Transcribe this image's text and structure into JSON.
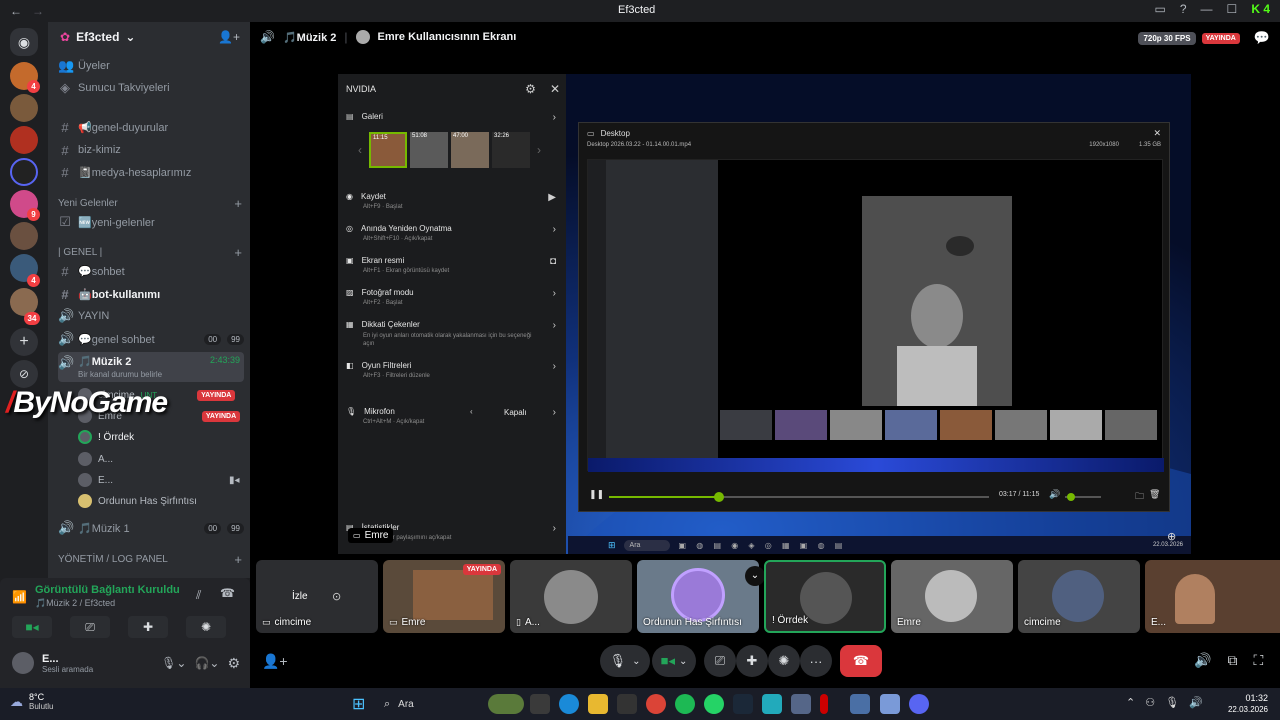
{
  "window": {
    "title": "Ef3cted",
    "nav_back": "←",
    "nav_fwd": "→"
  },
  "server": {
    "name": "Ef3cted",
    "items": [
      {
        "label": "Üyeler"
      },
      {
        "label": "Sunucu Takviyeleri"
      }
    ]
  },
  "channels": {
    "text": [
      {
        "label": "📢genel-duyurular"
      },
      {
        "label": "biz-kimiz"
      },
      {
        "label": "📓medya-hesaplarımız"
      }
    ],
    "cat_new": "Yeni Gelenler",
    "new_channel": "🆕yeni-gelenler",
    "cat_genel": "| GENEL |",
    "genel": [
      {
        "label": "💬sohbet"
      },
      {
        "label": "🤖bot-kullanımı"
      },
      {
        "label": "YAYIN"
      },
      {
        "label": "💬genel sohbet",
        "pill_a": "00",
        "pill_b": "99"
      }
    ],
    "voice_active": {
      "label": "🎵Müzik 2",
      "time": "2:43:39",
      "status": "Bir kanal durumu belirle"
    },
    "users": [
      {
        "name": "cimcime",
        "tag": "UNT",
        "live": "YAYINDA"
      },
      {
        "name": "Emre",
        "live": "YAYINDA"
      },
      {
        "name": "! Örrdek"
      },
      {
        "name": "A..."
      },
      {
        "name": "E..."
      },
      {
        "name": "Ordunun Has Şirfıntısı"
      }
    ],
    "voice2": {
      "label": "🎵Müzik 1",
      "pill_a": "00",
      "pill_b": "99"
    },
    "cat_yonetim": "YÖNETİM / LOG PANEL"
  },
  "watermark": "ByNoGame",
  "voice_panel": {
    "status": "Görüntülü Bağlantı Kuruldu",
    "channel": "🎵Müzik 2 / Ef3cted",
    "user": "E...",
    "user_status": "Sesli aramada"
  },
  "stage": {
    "channel": "🎵Müzik 2",
    "title": "Emre Kullanıcısının Ekranı",
    "quality": "720p 30 FPS",
    "live": "YAYINDA",
    "presenter": "Emre"
  },
  "nvidia": {
    "title": "NVIDIA",
    "gallery": "Galeri",
    "thumbs": [
      "11:15",
      "51:08",
      "47:00",
      "32:26"
    ],
    "rows": [
      {
        "title": "Kaydet",
        "sub": "Alt+F9 · Başlat"
      },
      {
        "title": "Anında Yeniden Oynatma",
        "sub": "Alt+Shift+F10 · Açık/kapat"
      },
      {
        "title": "Ekran resmi",
        "sub": "Alt+F1 · Ekran görüntüsü kaydet"
      },
      {
        "title": "Fotoğraf modu",
        "sub": "Alt+F2 · Başlat"
      },
      {
        "title": "Dikkati Çekenler",
        "sub": "En iyi oyun anları otomatik olarak yakalanması için bu seçeneği açın"
      },
      {
        "title": "Oyun Filtreleri",
        "sub": "Alt+F3 · Filtreleri düzenle"
      },
      {
        "title": "Mikrofon",
        "sub": "Ctrl+Alt+M · Açık/kapat",
        "value": "Kapalı"
      },
      {
        "title": "İstatistikler",
        "sub": "İstatistik yer paylaşımını aç/kapat"
      }
    ]
  },
  "desktop_window": {
    "title": "Desktop",
    "file": "Desktop 2026.03.22 - 01.14.00.01.mp4",
    "resolution": "1920x1080",
    "size": "1.35 GB",
    "time": "03:17 / 11:15",
    "progress": 0.29
  },
  "inner_taskbar": {
    "search": "Ara",
    "date": "22.03.2026"
  },
  "tiles": [
    {
      "name": "cimcime",
      "action": "İzle"
    },
    {
      "name": "Emre",
      "live": "YAYINDA"
    },
    {
      "name": "A..."
    },
    {
      "name": "Ordunun Has Şirfıntısı"
    },
    {
      "name": "! Örrdek"
    },
    {
      "name": "Emre"
    },
    {
      "name": "cimcime"
    },
    {
      "name": "E..."
    }
  ],
  "taskbar": {
    "weather_temp": "8°C",
    "weather_desc": "Bulutlu",
    "search": "Ara",
    "time": "01:32",
    "date": "22.03.2026"
  },
  "colors": {
    "accent": "#23a559",
    "live": "#da373c",
    "blurple": "#5865f2"
  }
}
